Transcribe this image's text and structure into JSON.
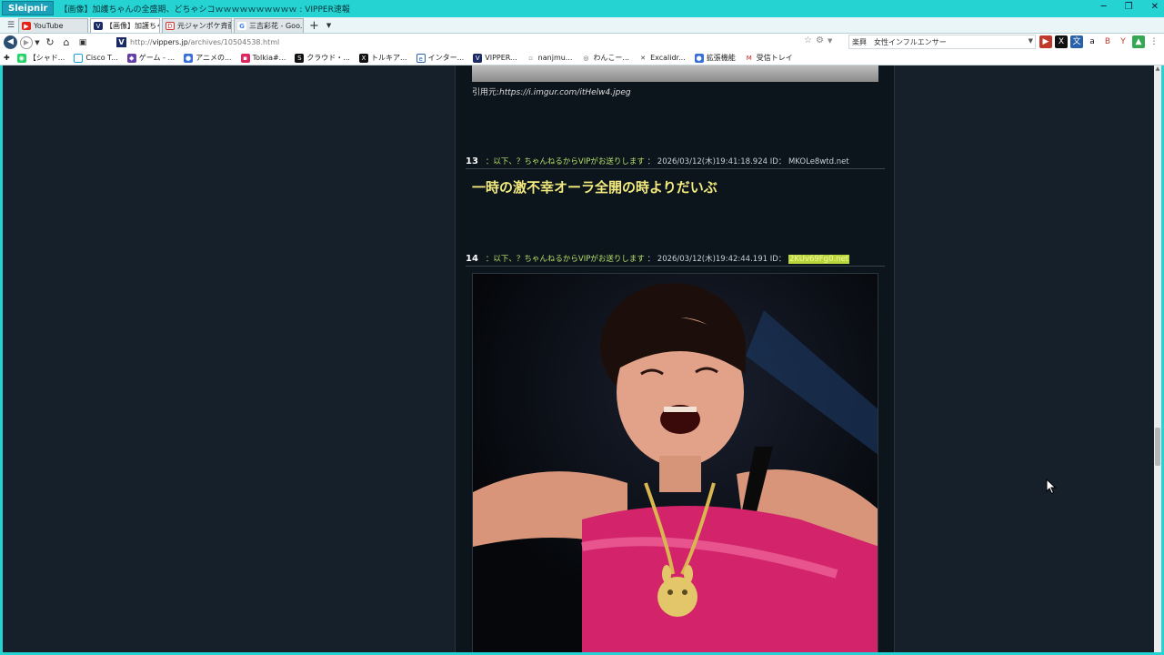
{
  "window": {
    "app_name": "Sleipnir",
    "title": "【画像】加護ちゃんの全盛期、どちゃシコｗｗｗｗｗｗｗｗｗｗ : VIPPER速報"
  },
  "tabs": [
    {
      "label": "YouTube",
      "icon": "youtube-icon",
      "active": false
    },
    {
      "label": "【画像】加護ちゃ...",
      "icon": "vipper-icon",
      "active": true
    },
    {
      "label": "元ジャンポケ斉藤...",
      "icon": "news-icon",
      "active": false
    },
    {
      "label": "三吉彩花 - Goo...",
      "icon": "google-icon",
      "active": false
    }
  ],
  "address": {
    "url_prefix": "http://",
    "url_host": "vippers.jp",
    "url_path": "/archives/10504538.html",
    "search_text": "楽興　女性インフルエンサー"
  },
  "bookmarks": [
    "【シャド...",
    "Cisco T...",
    "ゲーム - ...",
    "アニメの...",
    "Tolkia#...",
    "クラウド・...",
    "トルキア...",
    "インター...",
    "VIPPER...",
    "nanjmu...",
    "わんこー...",
    "Excalidr...",
    "拡張機能",
    "受信トレイ"
  ],
  "article": {
    "cite_label": "引用元:",
    "cite_url": "https://i.imgur.com/itHelw4.jpeg",
    "posts": [
      {
        "num": "13",
        "name": "：以下、？ちゃんねるからVIPがお送りします",
        "date": "： 2026/03/12(木)19:41:18.924 ID：",
        "id": "MKOLe8wtd.net",
        "highlight": false,
        "body": "一時の激不幸オーラ全開の時よりだいぶ"
      },
      {
        "num": "14",
        "name": "：以下、？ちゃんねるからVIPがお送りします",
        "date": "： 2026/03/12(木)19:42:44.191 ID：",
        "id": "2KUv69Fg0.net",
        "highlight": true,
        "body": ""
      }
    ]
  },
  "colors": {
    "page_bg": "#15202b",
    "column_bg": "#0c141c",
    "post_text": "#f3ea7e",
    "name_color": "#b6e06a",
    "id_highlight": "#b8d63a"
  }
}
